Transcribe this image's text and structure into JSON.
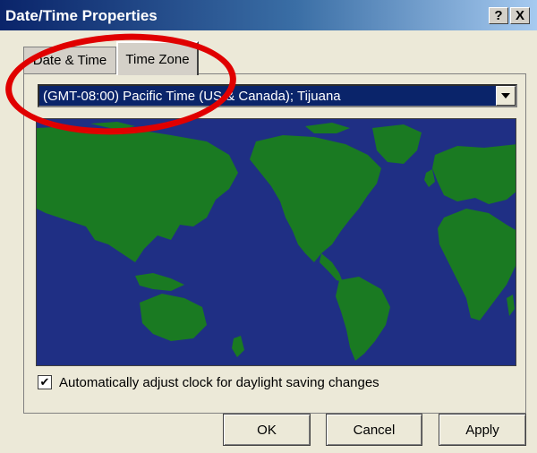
{
  "window": {
    "title": "Date/Time Properties",
    "help_label": "?",
    "close_label": "X"
  },
  "tabs": [
    {
      "label": "Date & Time",
      "active": false
    },
    {
      "label": "Time Zone",
      "active": true
    }
  ],
  "timezone": {
    "selected": "(GMT-08:00) Pacific Time (US & Canada); Tijuana"
  },
  "daylight": {
    "checked": true,
    "label": "Automatically adjust clock for daylight saving changes"
  },
  "buttons": {
    "ok": "OK",
    "cancel": "Cancel",
    "apply": "Apply"
  },
  "colors": {
    "map_ocean": "#1f2f84",
    "map_land": "#1a7a22",
    "annotation_circle": "#e00000"
  }
}
